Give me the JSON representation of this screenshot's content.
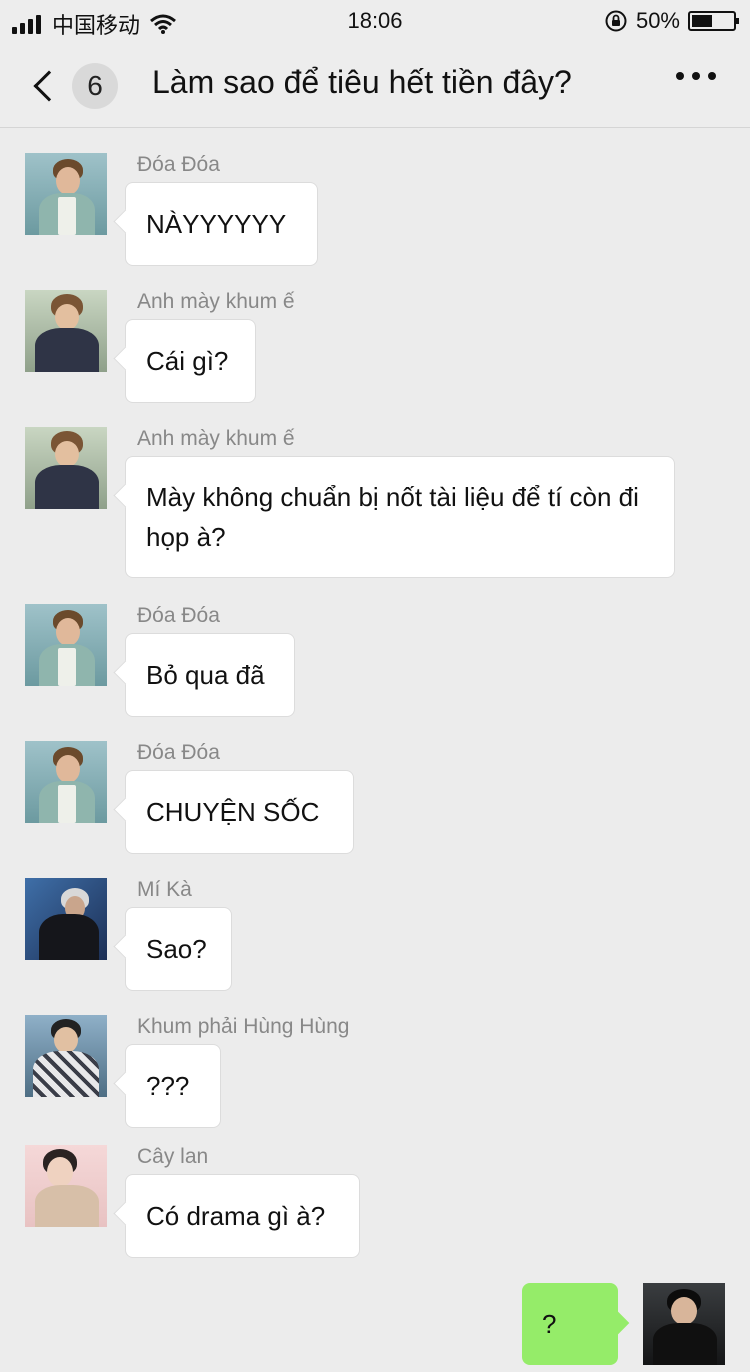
{
  "status_bar": {
    "carrier": "中国移动",
    "time": "18:06",
    "battery": "50%",
    "battery_level": 0.5
  },
  "header": {
    "unread_count": "6",
    "title": "Làm sao để tiêu hết tiền đây?"
  },
  "messages": [
    {
      "sender": "Đóa Đóa",
      "text": "NÀYYYYYY",
      "avatar": "avatar-doa-doa"
    },
    {
      "sender": "Anh mày khum ế",
      "text": "Cái gì?",
      "avatar": "avatar-anh-may"
    },
    {
      "sender": "Anh mày khum ế",
      "text": "Mày không chuẩn bị nốt tài liệu để tí còn đi họp à?",
      "avatar": "avatar-anh-may"
    },
    {
      "sender": "Đóa Đóa",
      "text": "Bỏ qua đã",
      "avatar": "avatar-doa-doa"
    },
    {
      "sender": "Đóa Đóa",
      "text": "CHUYỆN SỐC",
      "avatar": "avatar-doa-doa"
    },
    {
      "sender": "Mí Kà",
      "text": "Sao?",
      "avatar": "avatar-mi-ka"
    },
    {
      "sender": "Khum phải Hùng Hùng",
      "text": "???",
      "avatar": "avatar-hung-hung"
    },
    {
      "sender": "Cây lan",
      "text": "Có drama gì à?",
      "avatar": "avatar-cay-lan"
    }
  ],
  "my_message": {
    "text": "?"
  },
  "colors": {
    "background": "#ececec",
    "own_bubble": "#95ec69",
    "other_bubble": "#ffffff",
    "sender_name": "#888888"
  }
}
